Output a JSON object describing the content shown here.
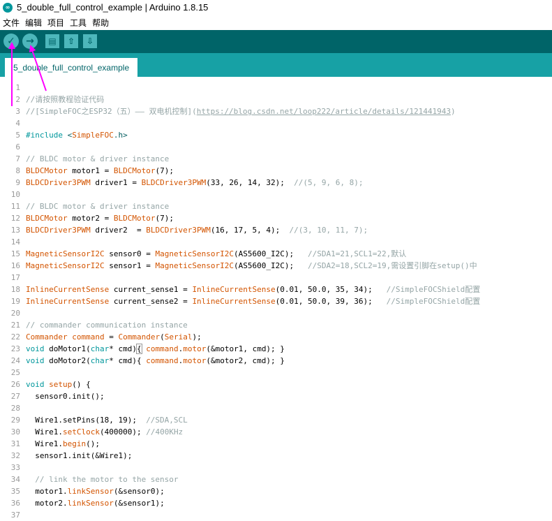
{
  "window": {
    "title": "5_double_full_control_example | Arduino 1.8.15",
    "app_icon": "arduino-logo-icon"
  },
  "menu": {
    "items": [
      "文件",
      "编辑",
      "项目",
      "工具",
      "帮助"
    ]
  },
  "toolbar": {
    "buttons": [
      {
        "name": "verify-button",
        "icon": "checkmark-icon",
        "glyph": "✓"
      },
      {
        "name": "upload-button",
        "icon": "right-arrow-icon",
        "glyph": "→"
      },
      {
        "name": "new-button",
        "icon": "new-file-icon",
        "glyph": "▤"
      },
      {
        "name": "open-button",
        "icon": "up-arrow-icon",
        "glyph": "⇧"
      },
      {
        "name": "save-button",
        "icon": "down-arrow-icon",
        "glyph": "⇩"
      }
    ]
  },
  "tab": {
    "label": "5_double_full_control_example"
  },
  "annotation_color": "#ff00ff",
  "colors": {
    "toolbar": "#006468",
    "tabbar": "#17a1a5",
    "button": "#4db7bb",
    "type": "#d35400",
    "keyword": "#00979c",
    "comment": "#95a5a6"
  },
  "code_lines": [
    [],
    [
      [
        "c",
        "//请按照教程验证代码"
      ]
    ],
    [
      [
        "c",
        "//[SimpleFOC之ESP32（五）—— 双电机控制]("
      ],
      [
        "l",
        "https://blog.csdn.net/loop222/article/details/121441943"
      ],
      [
        "c",
        ")"
      ]
    ],
    [],
    [
      [
        "k",
        "#include "
      ],
      [
        "s",
        "<"
      ],
      [
        "t",
        "SimpleFOC"
      ],
      [
        "s",
        ".h>"
      ]
    ],
    [],
    [
      [
        "c",
        "// BLDC motor & driver instance"
      ]
    ],
    [
      [
        "t",
        "BLDCMotor"
      ],
      [
        "p",
        " motor1 = "
      ],
      [
        "t",
        "BLDCMotor"
      ],
      [
        "p",
        "(7);"
      ]
    ],
    [
      [
        "t",
        "BLDCDriver3PWM"
      ],
      [
        "p",
        " driver1 = "
      ],
      [
        "t",
        "BLDCDriver3PWM"
      ],
      [
        "p",
        "(33, 26, 14, 32);  "
      ],
      [
        "c",
        "//(5, 9, 6, 8);"
      ]
    ],
    [],
    [
      [
        "c",
        "// BLDC motor & driver instance"
      ]
    ],
    [
      [
        "t",
        "BLDCMotor"
      ],
      [
        "p",
        " motor2 = "
      ],
      [
        "t",
        "BLDCMotor"
      ],
      [
        "p",
        "(7);"
      ]
    ],
    [
      [
        "t",
        "BLDCDriver3PWM"
      ],
      [
        "p",
        " driver2  = "
      ],
      [
        "t",
        "BLDCDriver3PWM"
      ],
      [
        "p",
        "(16, 17, 5, 4);  "
      ],
      [
        "c",
        "//(3, 10, 11, 7);"
      ]
    ],
    [],
    [
      [
        "t",
        "MagneticSensorI2C"
      ],
      [
        "p",
        " sensor0 = "
      ],
      [
        "t",
        "MagneticSensorI2C"
      ],
      [
        "p",
        "(AS5600_I2C);   "
      ],
      [
        "c",
        "//SDA1=21,SCL1=22,默认"
      ]
    ],
    [
      [
        "t",
        "MagneticSensorI2C"
      ],
      [
        "p",
        " sensor1 = "
      ],
      [
        "t",
        "MagneticSensorI2C"
      ],
      [
        "p",
        "(AS5600_I2C);   "
      ],
      [
        "c",
        "//SDA2=18,SCL2=19,需设置引脚在setup()中"
      ]
    ],
    [],
    [
      [
        "t",
        "InlineCurrentSense"
      ],
      [
        "p",
        " current_sense1 = "
      ],
      [
        "t",
        "InlineCurrentSense"
      ],
      [
        "p",
        "(0.01, 50.0, 35, 34);   "
      ],
      [
        "c",
        "//SimpleFOCShield配置"
      ]
    ],
    [
      [
        "t",
        "InlineCurrentSense"
      ],
      [
        "p",
        " current_sense2 = "
      ],
      [
        "t",
        "InlineCurrentSense"
      ],
      [
        "p",
        "(0.01, 50.0, 39, 36);   "
      ],
      [
        "c",
        "//SimpleFOCShield配置"
      ]
    ],
    [],
    [
      [
        "c",
        "// commander communication instance"
      ]
    ],
    [
      [
        "t",
        "Commander"
      ],
      [
        "p",
        " "
      ],
      [
        "t",
        "command"
      ],
      [
        "p",
        " = "
      ],
      [
        "t",
        "Commander"
      ],
      [
        "p",
        "("
      ],
      [
        "t",
        "Serial"
      ],
      [
        "p",
        ");"
      ]
    ],
    [
      [
        "k",
        "void"
      ],
      [
        "p",
        " doMotor1("
      ],
      [
        "k",
        "char"
      ],
      [
        "p",
        "* cmd)"
      ],
      [
        "x",
        "{"
      ],
      [
        "p",
        " "
      ],
      [
        "t",
        "command"
      ],
      [
        "p",
        "."
      ],
      [
        "t",
        "motor"
      ],
      [
        "p",
        "(&motor1, cmd); }"
      ]
    ],
    [
      [
        "k",
        "void"
      ],
      [
        "p",
        " doMotor2("
      ],
      [
        "k",
        "char"
      ],
      [
        "p",
        "* cmd){ "
      ],
      [
        "t",
        "command"
      ],
      [
        "p",
        "."
      ],
      [
        "t",
        "motor"
      ],
      [
        "p",
        "(&motor2, cmd); }"
      ]
    ],
    [],
    [
      [
        "k",
        "void"
      ],
      [
        "p",
        " "
      ],
      [
        "t",
        "setup"
      ],
      [
        "p",
        "() {"
      ]
    ],
    [
      [
        "p",
        "  sensor0.init();"
      ]
    ],
    [],
    [
      [
        "p",
        "  Wire1.setPins(18, 19);  "
      ],
      [
        "c",
        "//SDA,SCL"
      ]
    ],
    [
      [
        "p",
        "  Wire1."
      ],
      [
        "t",
        "setClock"
      ],
      [
        "p",
        "(400000); "
      ],
      [
        "c",
        "//400KHz"
      ]
    ],
    [
      [
        "p",
        "  Wire1."
      ],
      [
        "t",
        "begin"
      ],
      [
        "p",
        "();"
      ]
    ],
    [
      [
        "p",
        "  sensor1.init(&Wire1);"
      ]
    ],
    [],
    [
      [
        "c",
        "  // link the motor to the sensor"
      ]
    ],
    [
      [
        "p",
        "  motor1."
      ],
      [
        "t",
        "linkSensor"
      ],
      [
        "p",
        "(&sensor0);"
      ]
    ],
    [
      [
        "p",
        "  motor2."
      ],
      [
        "t",
        "linkSensor"
      ],
      [
        "p",
        "(&sensor1);"
      ]
    ],
    []
  ]
}
